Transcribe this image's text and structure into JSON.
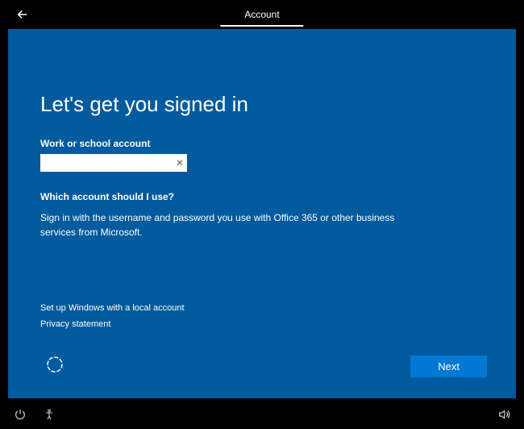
{
  "topbar": {
    "tab_account": "Account"
  },
  "main": {
    "heading": "Let's get you signed in",
    "field_label": "Work or school account",
    "input_value": "",
    "input_placeholder": "",
    "question": "Which account should I use?",
    "description": "Sign in with the username and password you use with Office 365 or other business services from Microsoft."
  },
  "links": {
    "local_account": "Set up Windows with a local account",
    "privacy": "Privacy statement"
  },
  "buttons": {
    "next": "Next"
  }
}
